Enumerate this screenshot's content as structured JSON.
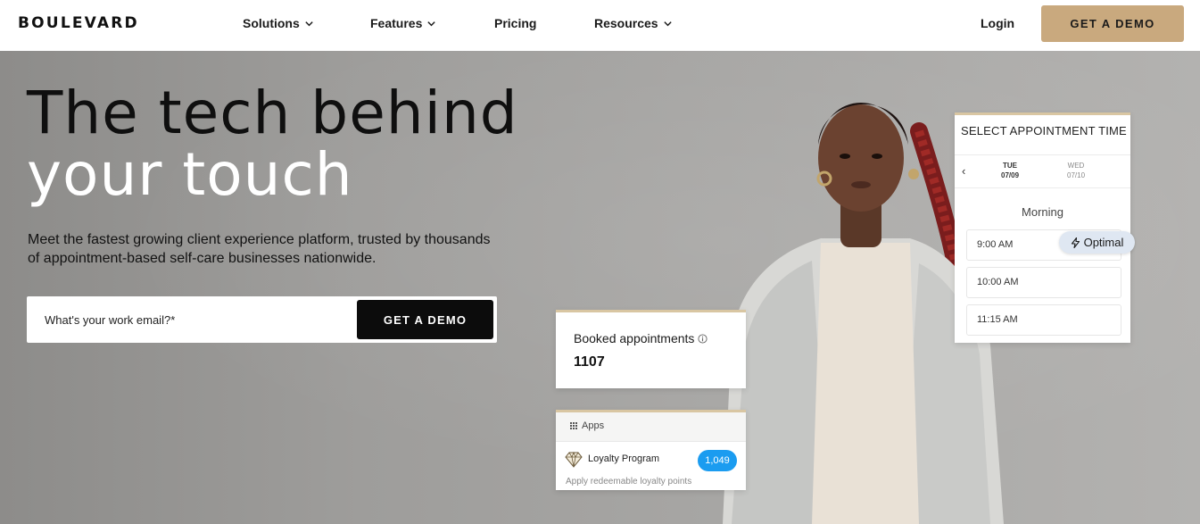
{
  "nav": {
    "logo": "BOULEVARD",
    "links": [
      {
        "label": "Solutions",
        "has_dropdown": true
      },
      {
        "label": "Features",
        "has_dropdown": true
      },
      {
        "label": "Pricing",
        "has_dropdown": false
      },
      {
        "label": "Resources",
        "has_dropdown": true
      }
    ],
    "login": "Login",
    "cta": "GET A DEMO"
  },
  "hero": {
    "headline_line1": "The tech behind",
    "headline_line2": "your touch",
    "subheadline": "Meet the fastest growing client experience platform, trusted by thousands of appointment-based self-care businesses nationwide.",
    "email_placeholder": "What's your work email?*",
    "email_button": "GET A DEMO"
  },
  "appointment_card": {
    "title": "SELECT APPOINTMENT TIME",
    "days": [
      {
        "weekday": "TUE",
        "date": "07/09",
        "selected": true
      },
      {
        "weekday": "WED",
        "date": "07/10",
        "selected": false
      }
    ],
    "period": "Morning",
    "slots": [
      "9:00 AM",
      "10:00 AM",
      "11:15 AM"
    ],
    "optimal_label": "Optimal"
  },
  "booked_card": {
    "label": "Booked appointments",
    "value": "1107"
  },
  "apps_card": {
    "title": "Apps",
    "item_label": "Loyalty Program",
    "item_count": "1,049",
    "item_description": "Apply redeemable loyalty points"
  },
  "colors": {
    "brand_gold": "#c9a97e",
    "card_accent": "#d9c6a2",
    "badge_blue": "#1b9cf0",
    "button_black": "#0c0c0c"
  }
}
